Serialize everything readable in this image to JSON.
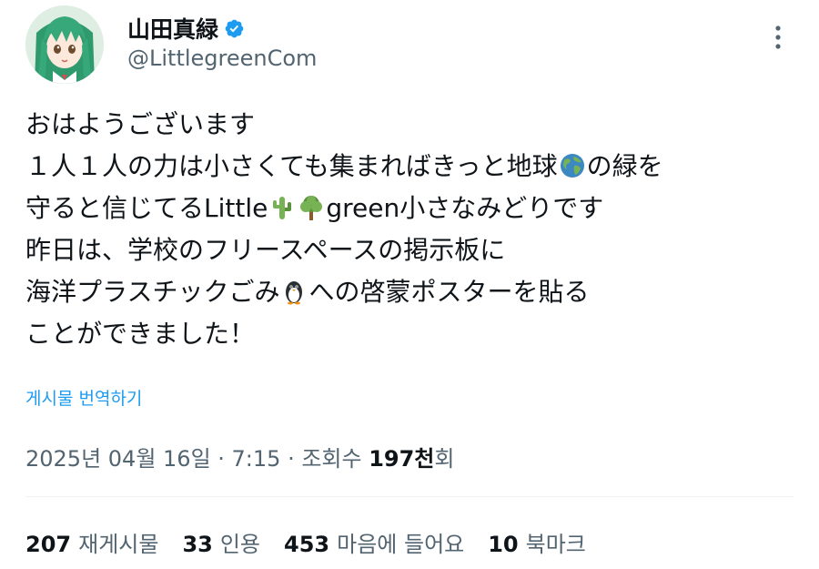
{
  "author": {
    "display_name": "山田真緑",
    "handle": "@LittlegreenCom",
    "verified": true,
    "avatar_icon": "anime-girl-avatar"
  },
  "more_icon": "more-vertical-icon",
  "post": {
    "lines": [
      {
        "parts": [
          {
            "text": "おはようございます"
          }
        ]
      },
      {
        "parts": [
          {
            "text": "１人１人の力は小さくても集まればきっと地球"
          },
          {
            "emoji": "globe-emoji"
          },
          {
            "text": "の緑を"
          }
        ]
      },
      {
        "parts": [
          {
            "text": "守ると信じてるLittle"
          },
          {
            "emoji": "cactus-emoji"
          },
          {
            "emoji": "tree-emoji"
          },
          {
            "text": "green小さなみどりです"
          }
        ]
      },
      {
        "parts": [
          {
            "text": "昨日は、学校のフリースペースの掲示板に"
          }
        ]
      },
      {
        "parts": [
          {
            "text": "海洋プラスチックごみ"
          },
          {
            "emoji": "penguin-emoji"
          },
          {
            "text": "への啓蒙ポスターを貼る"
          }
        ]
      },
      {
        "parts": [
          {
            "text": "ことができました！"
          }
        ]
      }
    ]
  },
  "translate_label": "게시물 번역하기",
  "meta": {
    "datetime": "2025년 04월 16일 · 7:15 · 조회수 ",
    "views_count": "197천",
    "views_suffix": "회"
  },
  "stats": [
    {
      "count": "207",
      "label": "재게시물"
    },
    {
      "count": "33",
      "label": "인용"
    },
    {
      "count": "453",
      "label": "마음에 들어요"
    },
    {
      "count": "10",
      "label": "북마크"
    }
  ],
  "colors": {
    "accent": "#1d9bf0",
    "text_primary": "#0f1419",
    "text_secondary": "#536471"
  }
}
